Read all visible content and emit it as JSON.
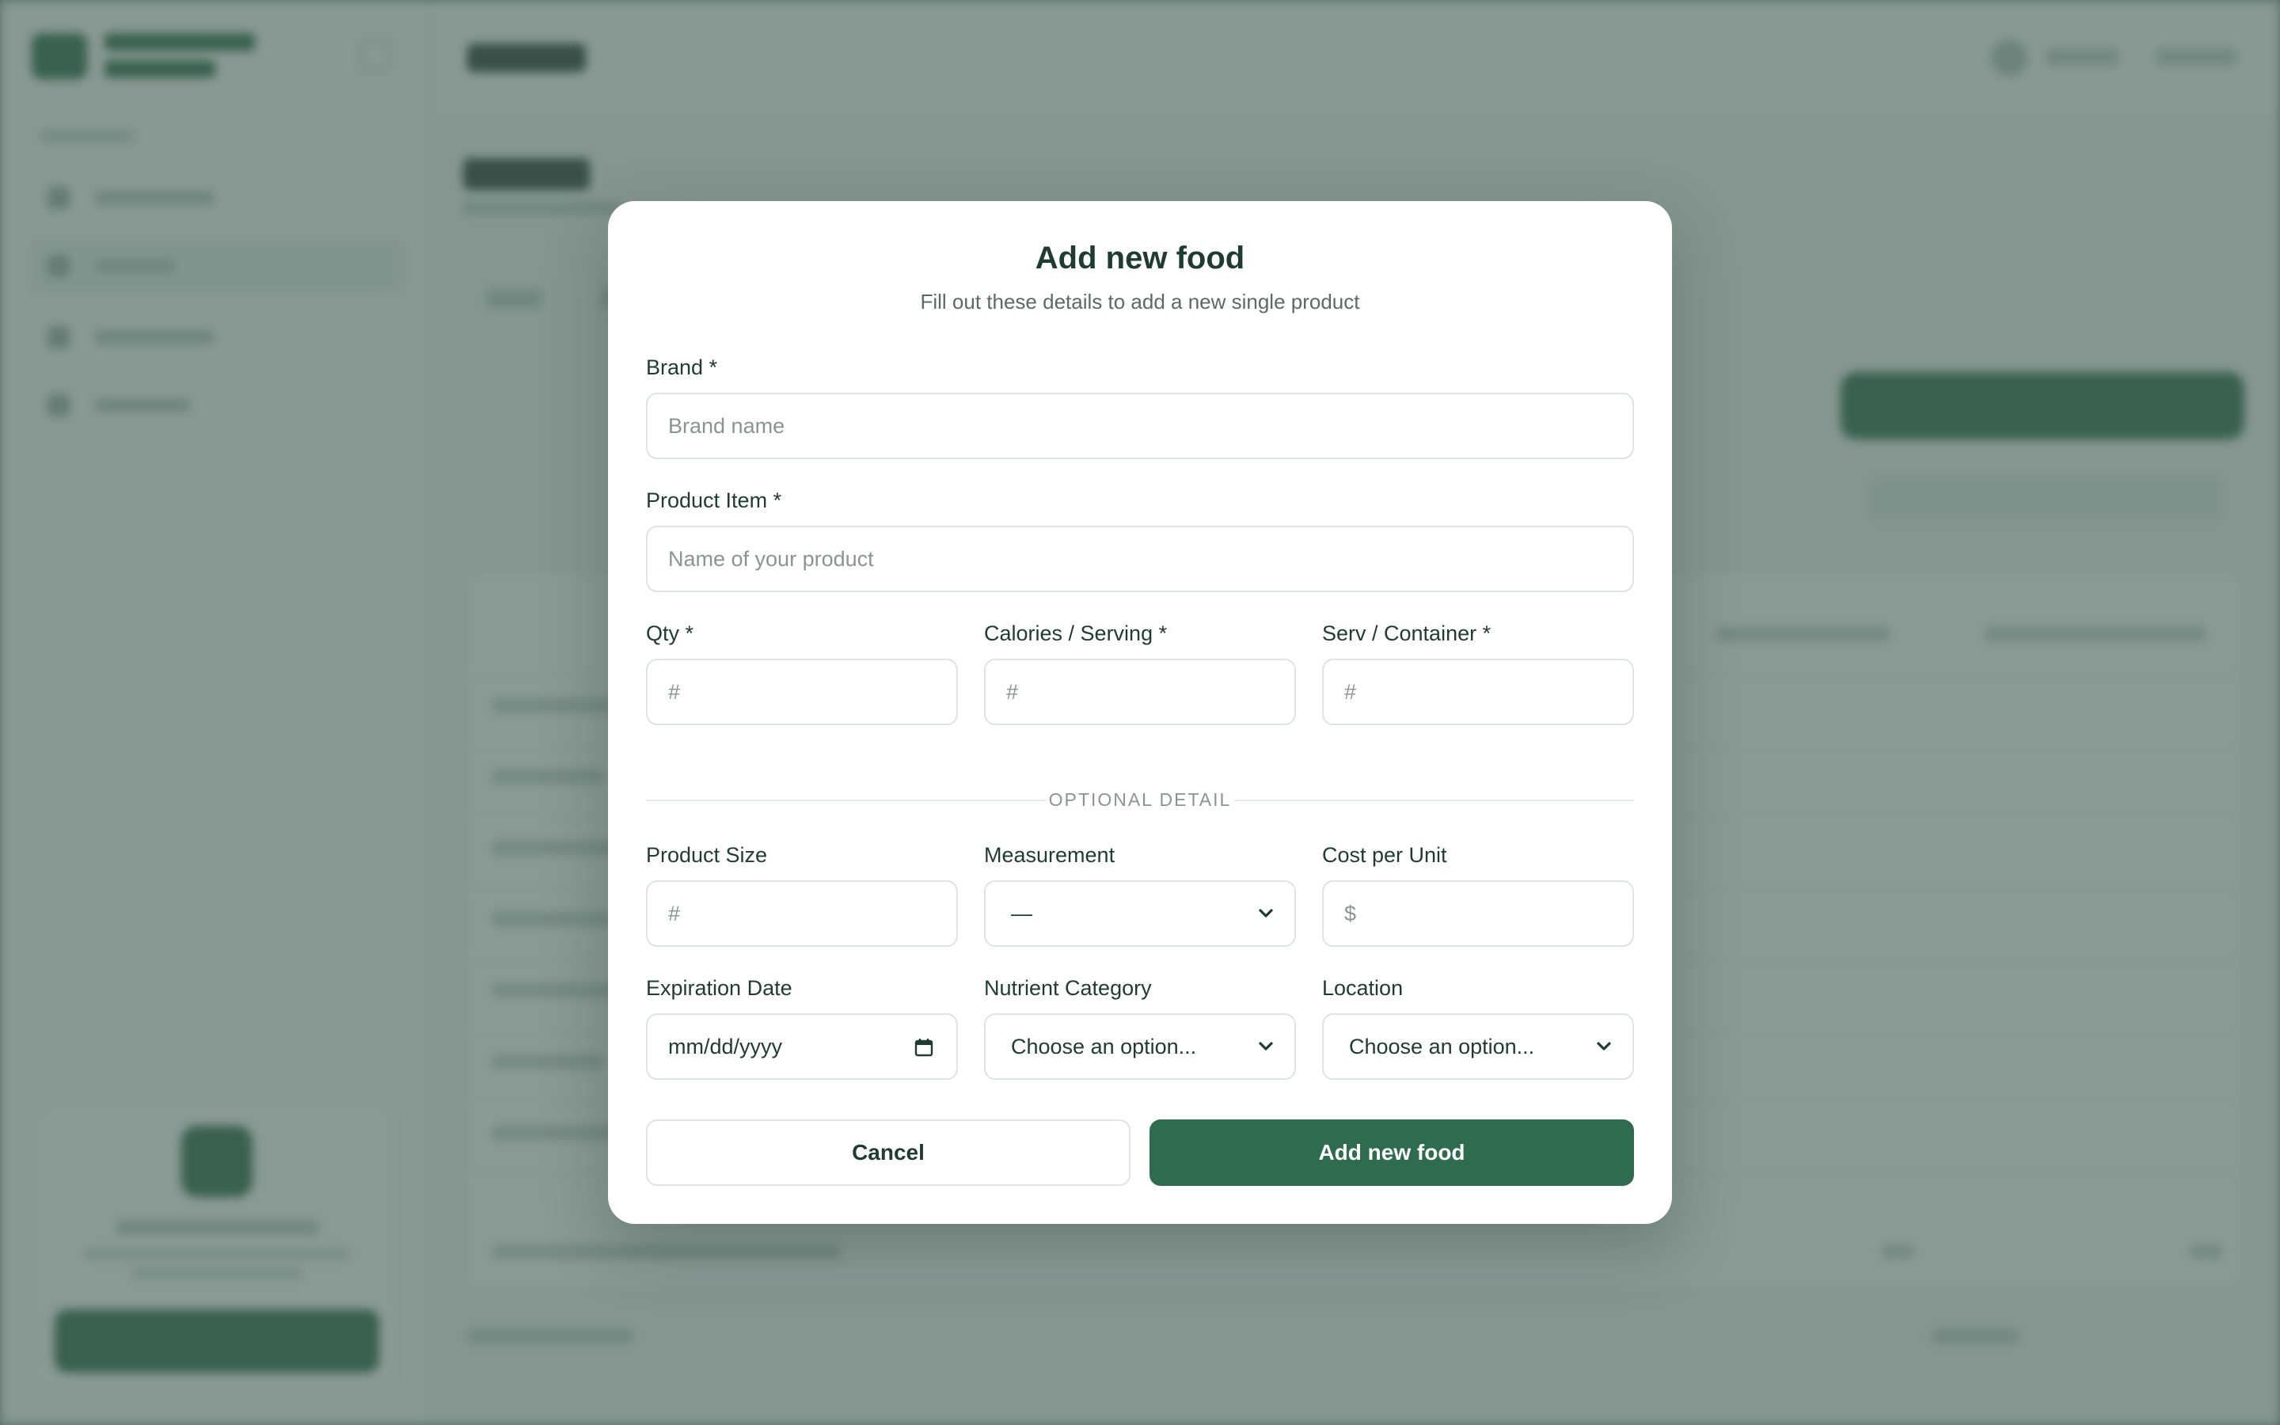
{
  "modal": {
    "title": "Add new food",
    "subtitle": "Fill out these details to add a new single product",
    "brand": {
      "label": "Brand *",
      "placeholder": "Brand name",
      "value": ""
    },
    "product_item": {
      "label": "Product Item *",
      "placeholder": "Name of your product",
      "value": ""
    },
    "qty": {
      "label": "Qty *",
      "placeholder": "#",
      "value": ""
    },
    "calories": {
      "label": "Calories / Serving *",
      "placeholder": "#",
      "value": ""
    },
    "serv_container": {
      "label": "Serv / Container *",
      "placeholder": "#",
      "value": ""
    },
    "divider_text": "OPTIONAL DETAIL",
    "product_size": {
      "label": "Product Size",
      "placeholder": "#",
      "value": ""
    },
    "measurement": {
      "label": "Measurement",
      "selected": "—"
    },
    "cost_per_unit": {
      "label": "Cost per Unit",
      "placeholder": "$",
      "value": ""
    },
    "expiration_date": {
      "label": "Expiration Date",
      "placeholder": "mm/dd/yyyy"
    },
    "nutrient_category": {
      "label": "Nutrient Category",
      "selected": "Choose an option..."
    },
    "location": {
      "label": "Location",
      "selected": "Choose an option..."
    },
    "cancel_label": "Cancel",
    "submit_label": "Add new food"
  },
  "colors": {
    "accent": "#2e6b4f",
    "heading": "#1f3b32",
    "overlay": "#405a52"
  },
  "icons": {
    "chevron": "chevron-down-icon",
    "calendar": "calendar-icon"
  }
}
